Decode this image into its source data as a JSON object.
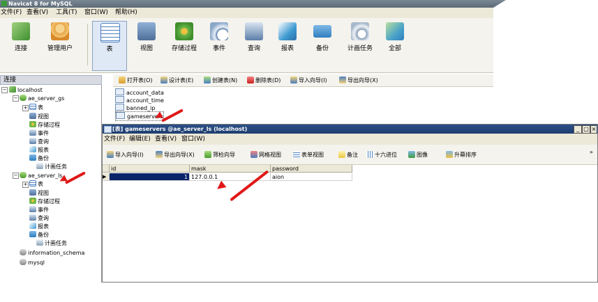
{
  "window": {
    "title": "Navicat 8 for MySQL"
  },
  "menubar": [
    "文件(F)",
    "查看(V)",
    "工具(T)",
    "窗口(W)",
    "帮助(H)"
  ],
  "toolbar": {
    "items": [
      {
        "label": "连接",
        "icon": "connection-icon",
        "color": "#5aa845"
      },
      {
        "label": "管理用户",
        "icon": "user-icon",
        "color": "#e8a448"
      },
      {
        "label": "表",
        "icon": "table-icon",
        "color": "#4a7fc0",
        "selected": true
      },
      {
        "label": "视图",
        "icon": "view-icon",
        "color": "#5c7fa8"
      },
      {
        "label": "存储过程",
        "icon": "procedure-icon",
        "color": "#6fb84a"
      },
      {
        "label": "事件",
        "icon": "event-icon",
        "color": "#5c7fa8"
      },
      {
        "label": "查询",
        "icon": "query-icon",
        "color": "#5c7fa8"
      },
      {
        "label": "报表",
        "icon": "report-icon",
        "color": "#3f9ad2"
      },
      {
        "label": "备份",
        "icon": "backup-icon",
        "color": "#2f7fbf"
      },
      {
        "label": "计画任务",
        "icon": "schedule-icon",
        "color": "#8aa0b8"
      },
      {
        "label": "全部",
        "icon": "all-icon",
        "color": "#4aa3c8"
      }
    ]
  },
  "left": {
    "header": "连接",
    "tree": [
      {
        "label": "localhost",
        "icon": "server-icon",
        "indent": 0
      },
      {
        "label": "ae_server_gs",
        "icon": "database-icon",
        "indent": 1
      },
      {
        "label": "表",
        "icon": "table-icon",
        "indent": 2
      },
      {
        "label": "视图",
        "icon": "view-icon",
        "indent": 2
      },
      {
        "label": "存储过程",
        "icon": "procedure-icon",
        "indent": 2
      },
      {
        "label": "事件",
        "icon": "event-icon",
        "indent": 2
      },
      {
        "label": "查询",
        "icon": "query-icon",
        "indent": 2
      },
      {
        "label": "报表",
        "icon": "report-icon",
        "indent": 2
      },
      {
        "label": "备份",
        "icon": "backup-icon",
        "indent": 2
      },
      {
        "label": "计画任务",
        "icon": "schedule-icon",
        "indent": 2
      },
      {
        "label": "ae_server_ls",
        "icon": "database-icon",
        "indent": 1
      },
      {
        "label": "表",
        "icon": "table-icon",
        "indent": 2
      },
      {
        "label": "视图",
        "icon": "view-icon",
        "indent": 2
      },
      {
        "label": "存储过程",
        "icon": "procedure-icon",
        "indent": 2
      },
      {
        "label": "事件",
        "icon": "event-icon",
        "indent": 2
      },
      {
        "label": "查询",
        "icon": "query-icon",
        "indent": 2
      },
      {
        "label": "报表",
        "icon": "report-icon",
        "indent": 2
      },
      {
        "label": "备份",
        "icon": "backup-icon",
        "indent": 2
      },
      {
        "label": "计画任务",
        "icon": "schedule-icon",
        "indent": 2
      },
      {
        "label": "information_schema",
        "icon": "database-gray-icon",
        "indent": 1
      },
      {
        "label": "mysql",
        "icon": "database-gray-icon",
        "indent": 1
      }
    ]
  },
  "objbar": [
    "打开表(O)",
    "设计表(E)",
    "创建表(N)",
    "删除表(D)",
    "导入向导(I)",
    "导出向导(X)"
  ],
  "tables": [
    "account_data",
    "account_time",
    "banned_ip",
    "gameservers"
  ],
  "inner": {
    "title": "[表] gameservers @ae_server_ls (localhost)",
    "menu": [
      "文件(F)",
      "编辑(E)",
      "查看(V)",
      "窗口(W)"
    ],
    "toolbar": [
      "导入向导(I)",
      "导出向导(X)",
      "筛检向导",
      "网格视图",
      "表单视图",
      "备注",
      "十六进位",
      "图像",
      "升幕排序"
    ],
    "columns": [
      "id",
      "mask",
      "password"
    ],
    "rows": [
      [
        "1",
        "127.0.0.1",
        "aion"
      ]
    ]
  },
  "colors": {
    "accent": "#2b4f86",
    "arrow": "#e01818",
    "selected_cell": "#0a246a"
  }
}
